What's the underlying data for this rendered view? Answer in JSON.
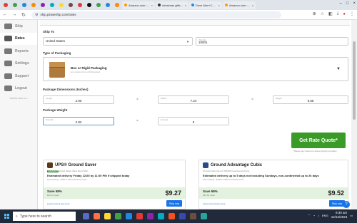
{
  "browser": {
    "tabs": [
      {
        "title": "Amazon.com : Th",
        "active": false
      },
      {
        "title": "christmas gifts - K",
        "active": false
      },
      {
        "title": "Dove Men+Care -",
        "active": false
      },
      {
        "title": "Amazon.com : Do",
        "active": false
      }
    ],
    "url": "ship.pirateship.com/rates"
  },
  "sidebar": {
    "items": [
      {
        "label": "Ship"
      },
      {
        "label": "Rates"
      },
      {
        "label": "Reports"
      },
      {
        "label": "Settings"
      },
      {
        "label": "Support"
      },
      {
        "label": "Logout"
      }
    ],
    "footer": "PIRATE SHIP LLC"
  },
  "form": {
    "ship_to_label": "Ship To",
    "country": "United States",
    "zip_label": "Zipcode",
    "zip": "10001",
    "packaging_label": "Type of Packaging",
    "package_title": "Box or Rigid Packaging",
    "package_sub": "Any custom box or thick parcel",
    "dimensions_label": "Package Dimensions (Inches)",
    "length_label": "Length",
    "length": "2.90",
    "width_label": "Width",
    "width": "7.24",
    "height_label": "Height",
    "height": "9.55",
    "weight_label": "Package Weight",
    "pounds_label": "Pounds",
    "pounds": "2.82",
    "ounces_label": "Ounces",
    "ounces": "0",
    "times": "×"
  },
  "quote": {
    "button": "Get Rate Quote*",
    "note": "*Rates vary based on actual shipping location"
  },
  "rates": [
    {
      "carrier": "UPS® Ground Saver",
      "badge": "CHEAPEST",
      "sub": "United States, Mass Bound Mail",
      "eta": "Estimated delivery Friday 12/20 by 11:00 PM if shipped today",
      "meta": "Free tracking · $100 in UPS Insurance Cover",
      "save": "Save 58%",
      "retail": "$22.19 retail",
      "price": "$9.27",
      "learn": "Learn more & see more",
      "ship": "Ship now",
      "color": "#5a3a1a"
    },
    {
      "carrier": "Ground Advantage Cubic",
      "badge": "",
      "sub": "US Cubic Rate Zone 8, 6800000 Guaranteed Pricing",
      "eta": "Estimated delivery up to 5 days not including Sundays, non-continental up to 26 days",
      "meta": "Free tracking · $100 in USPS Insurance Cover",
      "save": "Save 58%",
      "retail": "$19.53 retail",
      "price": "$9.52",
      "learn": "Learn more & see more",
      "ship": "Ship now",
      "color": "#2b4c8c"
    }
  ],
  "taskbar": {
    "search_placeholder": "Type here to search",
    "lang": "ENG",
    "time": "9:30 am",
    "date": "12/12/2024"
  },
  "colors": {
    "accent_green": "#3a9b29",
    "link_blue": "#1a73e8"
  }
}
